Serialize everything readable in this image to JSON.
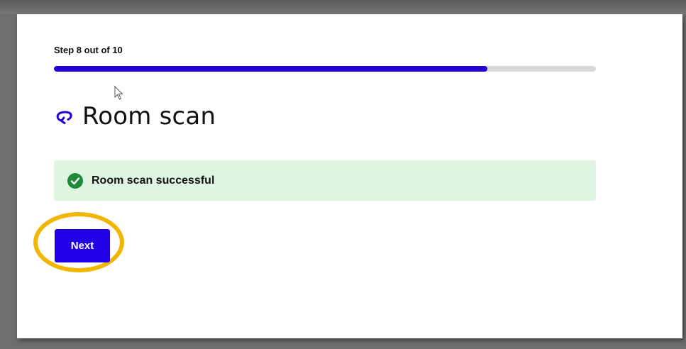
{
  "progress": {
    "step_label": "Step 8 out of 10",
    "current_step": 8,
    "total_steps": 10,
    "fraction": 0.8
  },
  "header": {
    "title": "Room scan",
    "icon": "rotate-arrow-icon"
  },
  "status": {
    "message": "Room scan successful",
    "icon": "check-circle-icon"
  },
  "actions": {
    "next_label": "Next"
  },
  "colors": {
    "accent": "#2200e6",
    "success_bg": "#dff5e1",
    "success_icon": "#1e8a3a",
    "highlight": "#f2b600"
  }
}
